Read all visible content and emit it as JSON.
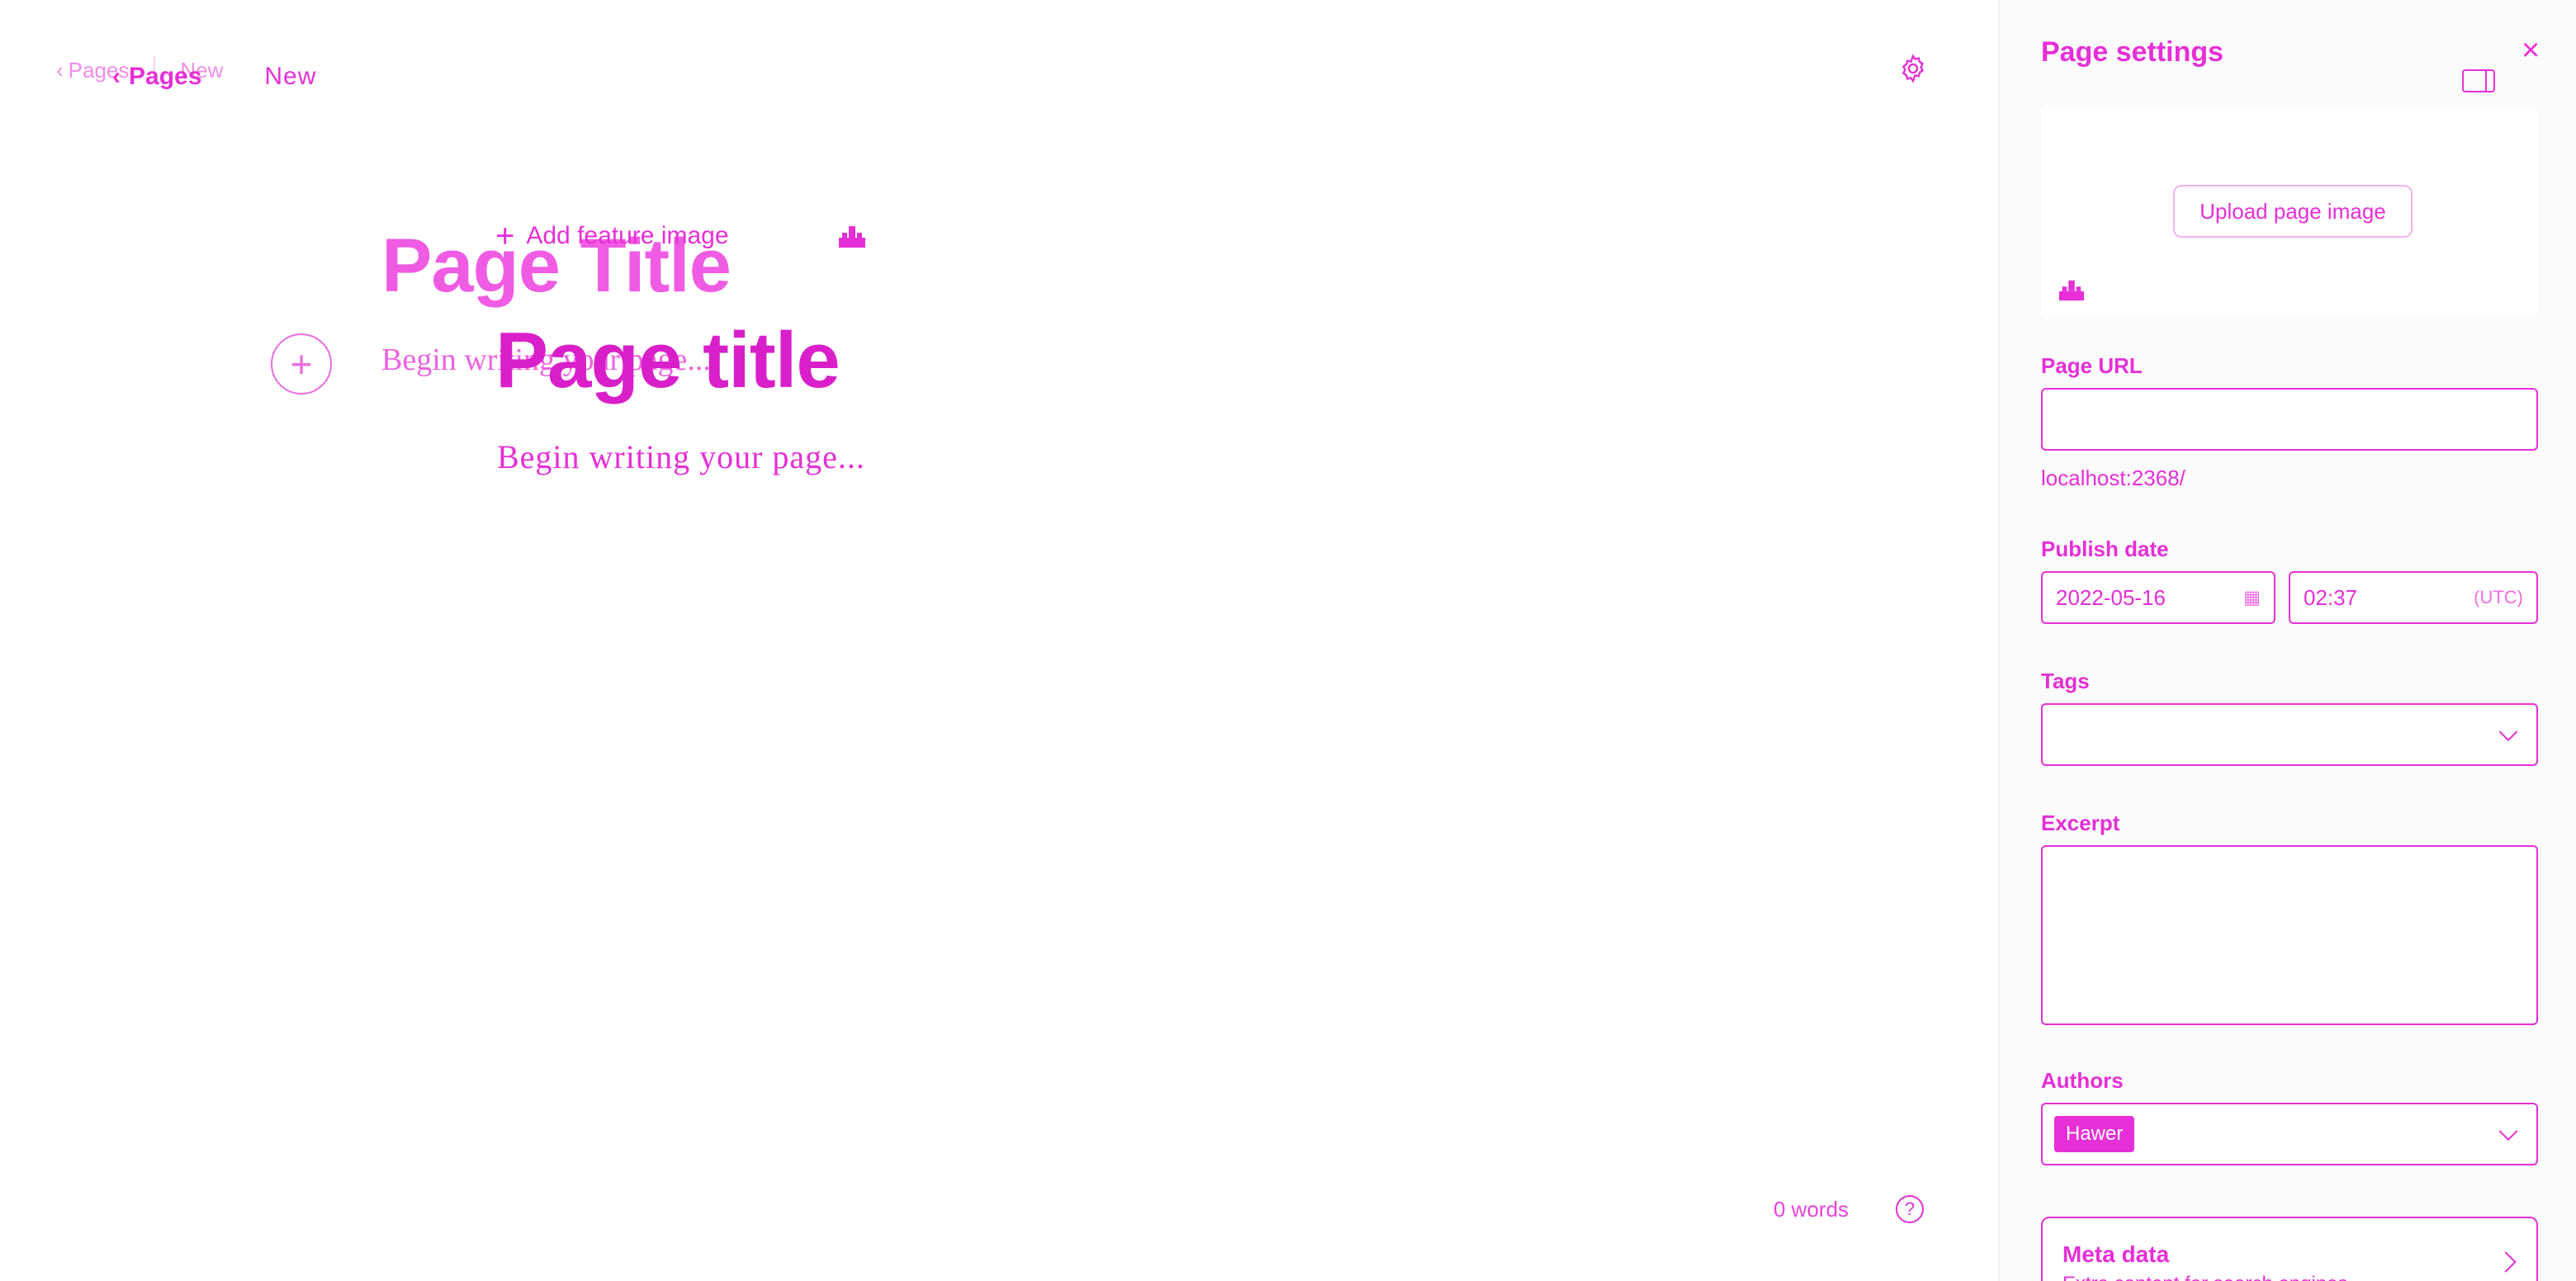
{
  "topbar": {
    "back_label": "Pages",
    "status": "New"
  },
  "editor": {
    "feature_image_label": "Add feature image",
    "ghost_title": "Page Title",
    "ghost_body_placeholder": "Begin writing your page...",
    "title_placeholder": "Page title",
    "body_placeholder": "Begin writing your page..."
  },
  "word_count": {
    "label": "0 words",
    "help": "?"
  },
  "settings": {
    "title": "Page settings",
    "upload_label": "Upload page image",
    "url_label": "Page URL",
    "url_value": "",
    "url_hint": "localhost:2368/",
    "publish_label": "Publish date",
    "date_value": "2022-05-16",
    "time_value": "02:37",
    "timezone": "(UTC)",
    "tags_label": "Tags",
    "excerpt_label": "Excerpt",
    "authors_label": "Authors",
    "author_name": "Hawer",
    "meta_title": "Meta data",
    "meta_subtitle": "Extra content for search engines"
  },
  "colors": {
    "accent": "#e62fd6",
    "panel_bg": "#fbfbfc"
  },
  "icons": [
    "chevron-left-icon",
    "gear-icon",
    "plus-icon",
    "image-icon",
    "close-icon",
    "sidebar-toggle-icon",
    "calendar-icon",
    "chevron-down-icon",
    "help-icon",
    "chevron-right-icon"
  ]
}
